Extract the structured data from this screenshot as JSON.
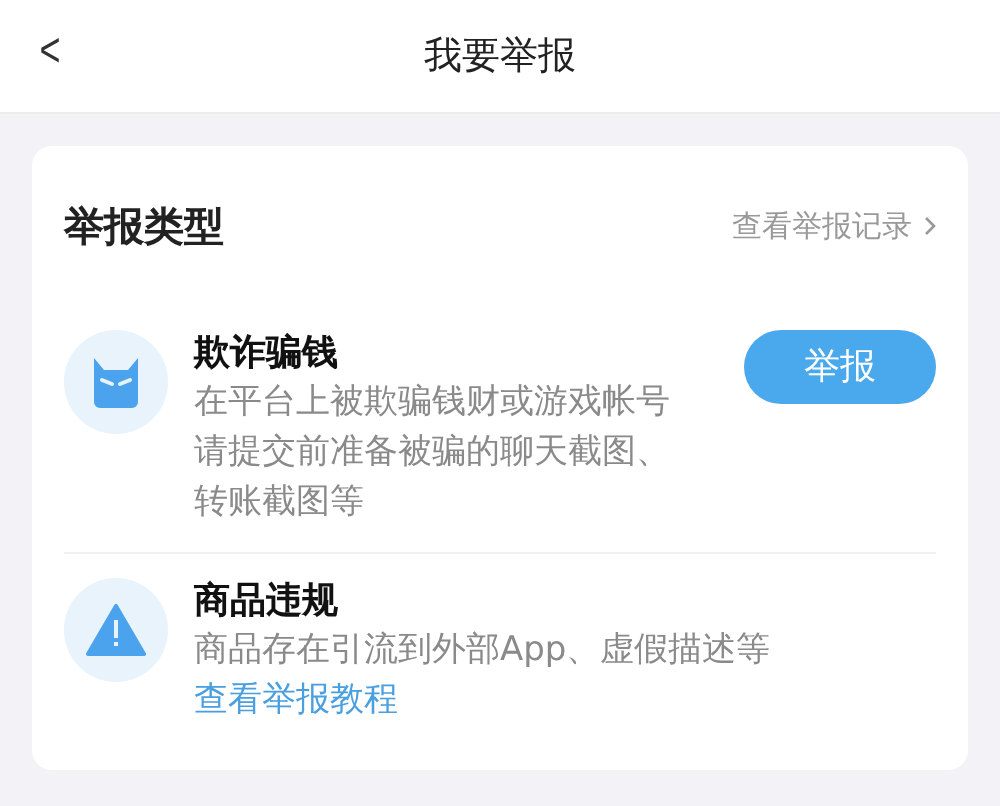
{
  "header": {
    "back_icon": "<",
    "title": "我要举报"
  },
  "section": {
    "title": "举报类型",
    "history_link": "查看举报记录"
  },
  "items": [
    {
      "kind": "fraud",
      "title": "欺诈骗钱",
      "description": "在平台上被欺骗钱财或游戏帐号请提交前准备被骗的聊天截图、转账截图等",
      "button": "举报"
    },
    {
      "kind": "warning",
      "title": "商品违规",
      "description": "商品存在引流到外部App、虚假描述等",
      "link": "查看举报教程"
    }
  ]
}
